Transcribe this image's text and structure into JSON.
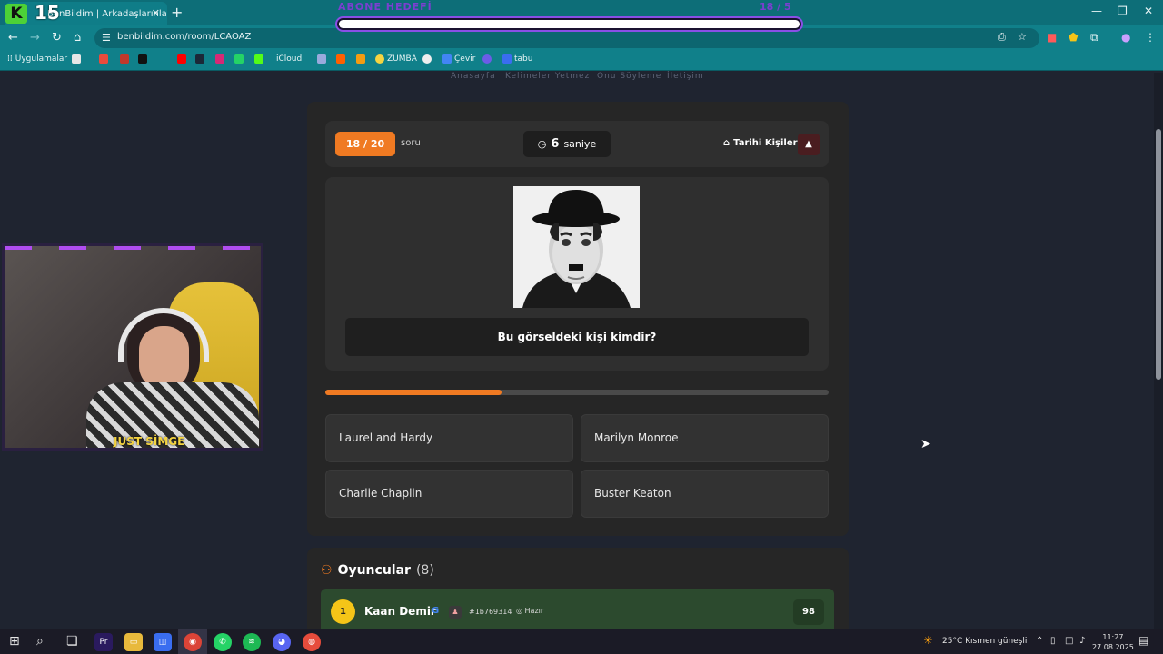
{
  "browser": {
    "tab_title": "BenBildim | Arkadaşlarınla Onl...",
    "tab_close": "✕",
    "new_tab": "+",
    "url": "benbildim.com/room/LCAOAZ",
    "bookmarks": [
      {
        "label": "Uygulamalar",
        "color": "#e6e6e6"
      },
      {
        "label": "iCloud",
        "color": "#ffffff"
      },
      {
        "label": "ZUMBA",
        "color": "#f5d442"
      },
      {
        "label": "Çevir",
        "color": "#4285f4"
      },
      {
        "label": "tabu",
        "color": "#3a6df0"
      }
    ]
  },
  "overlay": {
    "k_logo": "K",
    "k_count": "15",
    "sub_goal_label": "ABONE HEDEFİ",
    "sub_goal_count": "18 / 5",
    "sub_goal_progress": 1.0,
    "streamer_name": "JUST SİMGE"
  },
  "site_nav": [
    "Anasayfa",
    "Kelimeler Yetmez",
    "Onu Söyleme",
    "İletişim"
  ],
  "game": {
    "question_counter": "18 / 20",
    "question_label": "soru",
    "timer_value": "6",
    "timer_unit": "saniye",
    "category": "Tarihi Kişiler",
    "question": "Bu görseldeki kişi kimdir?",
    "time_progress": 0.35,
    "answers": [
      "Laurel and Hardy",
      "Marilyn Monroe",
      "Charlie Chaplin",
      "Buster Keaton"
    ]
  },
  "players": {
    "title": "Oyuncular",
    "count": "(8)",
    "list": [
      {
        "rank": "1",
        "name": "Kaan Demir",
        "id": "#1b769314",
        "status": "Hazır",
        "score": "98"
      }
    ]
  },
  "taskbar": {
    "weather": "25°C  Kısmen güneşli",
    "time": "11:27",
    "date": "27.08.2025"
  },
  "colors": {
    "accent": "#f07a22",
    "browser_teal": "#10808a",
    "player_row": "#2c4a2e"
  }
}
